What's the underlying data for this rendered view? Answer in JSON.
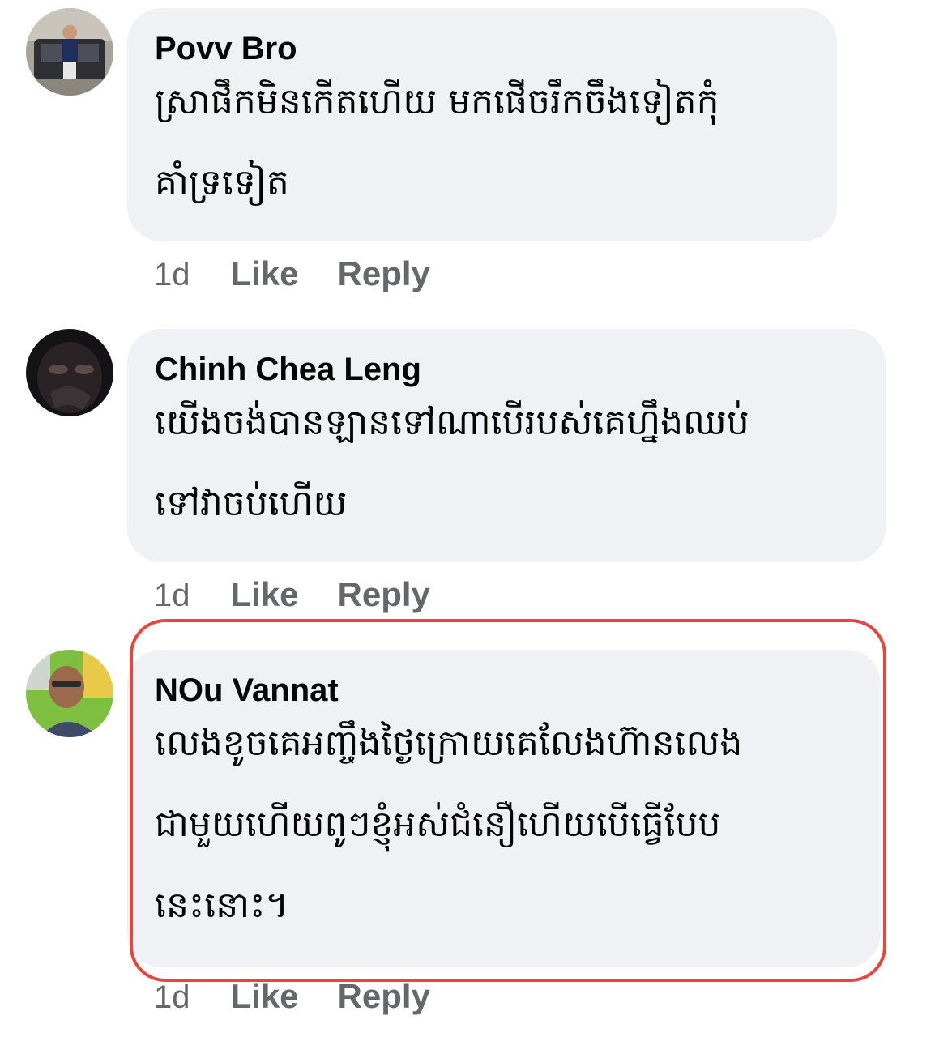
{
  "comments": [
    {
      "author": "Povv Bro",
      "text": "ស្រាផឹកមិនកើតហើយ មកផើចរឹកចឹងទៀតកុំ\nគាំទ្រទៀត",
      "time": "1d",
      "like_label": "Like",
      "reply_label": "Reply"
    },
    {
      "author": "Chinh Chea Leng",
      "text": "យើងចង់បានឡានទៅណាបើរបស់គេហ្នឹងឈប់\nទៅវាចប់ហើយ",
      "time": "1d",
      "like_label": "Like",
      "reply_label": "Reply"
    },
    {
      "author": "NOu Vannat",
      "text": "លេងខូចគេអញ្ចឹងថ្ងៃក្រោយគេលែងហ៊ានលេង\nជាមួយហើយពូៗខ្ញុំអស់ជំនឿហើយបើធ្វើបែប\nនេះនោះ។",
      "time": "1d",
      "like_label": "Like",
      "reply_label": "Reply"
    }
  ],
  "colors": {
    "bubble": "#f0f1f5",
    "highlight": "#e8453c",
    "secondary_text": "#65676b"
  }
}
